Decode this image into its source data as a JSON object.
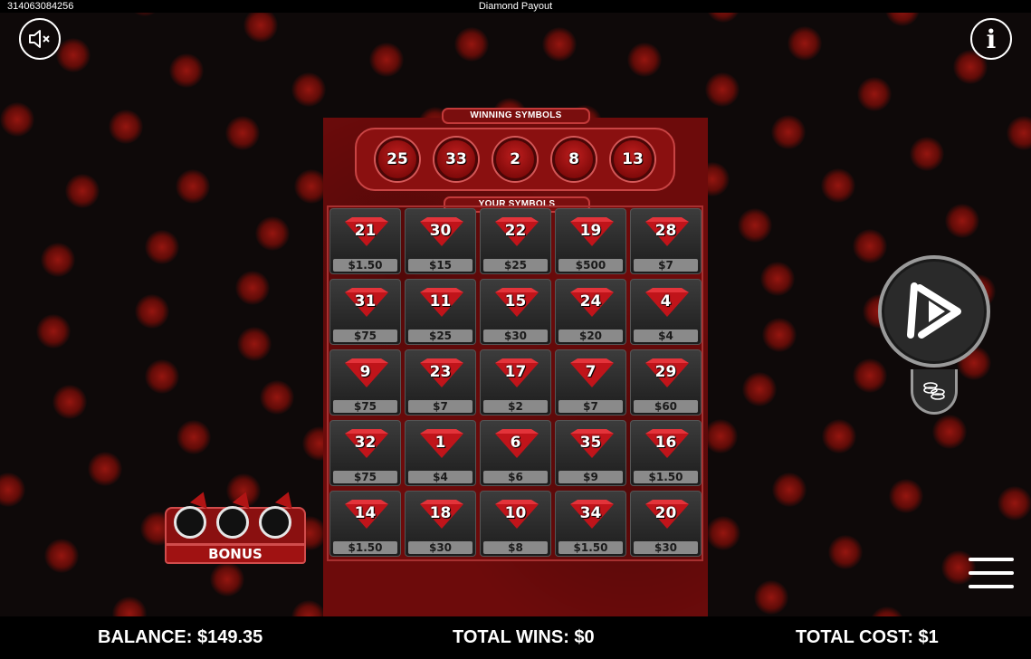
{
  "topbar": {
    "game_id": "314063084256",
    "title": "Diamond Payout"
  },
  "buttons": {
    "sound_icon": "speaker-muted-icon",
    "info_icon": "info-icon",
    "info_label": "i",
    "play_icon": "play-icon",
    "coins_icon": "coin-stack-icon",
    "menu_icon": "hamburger-menu-icon"
  },
  "card": {
    "winning_label": "WINNING SYMBOLS",
    "your_label": "YOUR SYMBOLS",
    "winning_numbers": [
      "25",
      "33",
      "2",
      "8",
      "13"
    ],
    "symbols": [
      {
        "number": "21",
        "prize": "$1.50"
      },
      {
        "number": "30",
        "prize": "$15"
      },
      {
        "number": "22",
        "prize": "$25"
      },
      {
        "number": "19",
        "prize": "$500"
      },
      {
        "number": "28",
        "prize": "$7"
      },
      {
        "number": "31",
        "prize": "$75"
      },
      {
        "number": "11",
        "prize": "$25"
      },
      {
        "number": "15",
        "prize": "$30"
      },
      {
        "number": "24",
        "prize": "$20"
      },
      {
        "number": "4",
        "prize": "$4"
      },
      {
        "number": "9",
        "prize": "$75"
      },
      {
        "number": "23",
        "prize": "$7"
      },
      {
        "number": "17",
        "prize": "$2"
      },
      {
        "number": "7",
        "prize": "$7"
      },
      {
        "number": "29",
        "prize": "$60"
      },
      {
        "number": "32",
        "prize": "$75"
      },
      {
        "number": "1",
        "prize": "$4"
      },
      {
        "number": "6",
        "prize": "$6"
      },
      {
        "number": "35",
        "prize": "$9"
      },
      {
        "number": "16",
        "prize": "$1.50"
      },
      {
        "number": "14",
        "prize": "$1.50"
      },
      {
        "number": "18",
        "prize": "$30"
      },
      {
        "number": "10",
        "prize": "$8"
      },
      {
        "number": "34",
        "prize": "$1.50"
      },
      {
        "number": "20",
        "prize": "$30"
      }
    ]
  },
  "bonus": {
    "label": "BONUS"
  },
  "footer": {
    "balance": "BALANCE: $149.35",
    "total_wins": "TOTAL WINS: $0",
    "total_cost": "TOTAL COST: $1"
  },
  "colors": {
    "accent_red": "#8a1010",
    "prize_bar": "#8a8a8a",
    "gem_red": "#c0141a"
  }
}
